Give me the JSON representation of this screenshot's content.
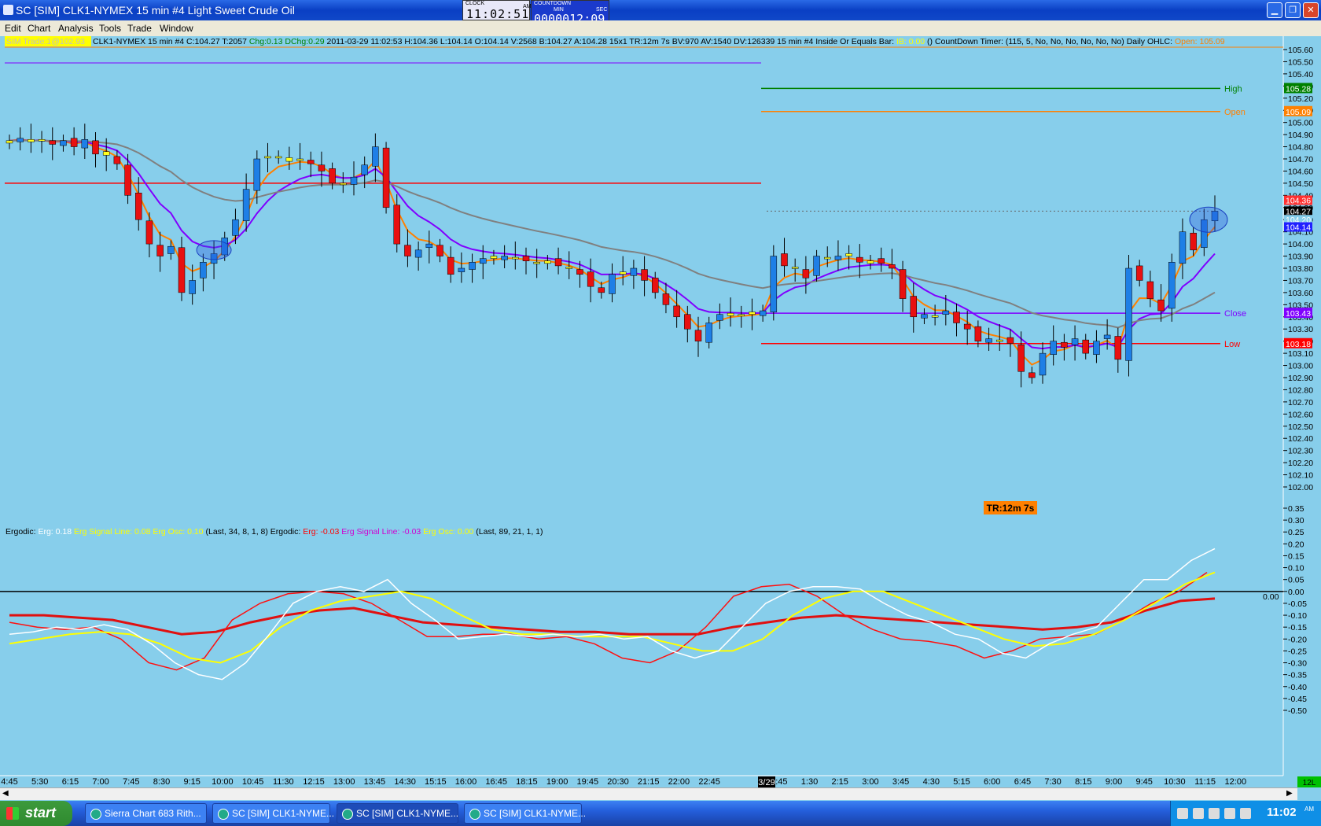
{
  "window": {
    "title": "SC [SIM] CLK1-NYMEX  15 min   #4  Light Sweet Crude Oil"
  },
  "clock": {
    "label": "CLOCK",
    "time": "11:02:51",
    "ampm": "AM"
  },
  "countdown": {
    "label": "COUNTDOWN",
    "min_label": "MIN",
    "sec_label": "SEC",
    "value": "0000012:09"
  },
  "menu": [
    "Edit",
    "Chart",
    "Analysis",
    "Tools",
    "Trade",
    "Window"
  ],
  "info_bar": {
    "sim_trade": "SIM  Trade:1@102.93",
    "segments": [
      {
        "text": "CLK1-NYMEX  15 min   #4 C:104.27 T:2057 ",
        "color": "#000000"
      },
      {
        "text": "Chg:0.13 DChg:0.29 ",
        "color": "#008000"
      },
      {
        "text": "2011-03-29 11:02:53 H:104.36 L:104.14 O:104.14 V:2568 B:104.27 A:104.28 15x1 TR:12m 7s BV:970 AV:1540 DV:126339 15 min  #4  Inside Or Equals Bar: ",
        "color": "#000000"
      },
      {
        "text": "IB: 0.00 ",
        "color": "#ffff00"
      },
      {
        "text": "  ()   CountDown Timer:   (115, 5, No, No, No, No, No, No)   Daily OHLC: ",
        "color": "#000000"
      },
      {
        "text": "Open: 105.09",
        "color": "#ff8000"
      }
    ]
  },
  "ergodic_bar": {
    "segments": [
      {
        "text": "Ergodic:  ",
        "color": "#000000"
      },
      {
        "text": "Erg: 0.18  ",
        "color": "#ffffff"
      },
      {
        "text": "Erg Signal Line: 0.08  ",
        "color": "#ffff00"
      },
      {
        "text": "Erg Osc: 0.10  ",
        "color": "#ffff00"
      },
      {
        "text": "  (Last, 34, 8, 1, 8)   Ergodic:  ",
        "color": "#000000"
      },
      {
        "text": "Erg: -0.03  ",
        "color": "#ff0000"
      },
      {
        "text": "Erg Signal Line: -0.03  ",
        "color": "#d000d0"
      },
      {
        "text": "Erg Osc: 0.00  ",
        "color": "#ffff00"
      },
      {
        "text": "  (Last, 89, 21, 1, 1)",
        "color": "#000000"
      }
    ]
  },
  "levels": [
    {
      "name": "High",
      "value": "105.28",
      "color": "#008000"
    },
    {
      "name": "Open",
      "value": "105.09",
      "color": "#ff8000"
    },
    {
      "name": "Close",
      "value": "103.43",
      "color": "#8000ff"
    },
    {
      "name": "Low",
      "value": "103.18",
      "color": "#ff0000"
    }
  ],
  "price_tags": [
    {
      "value": "104.36",
      "bg": "#ff3030",
      "fg": "#ffffff"
    },
    {
      "value": "104.27",
      "bg": "#000000",
      "fg": "#ffffff"
    },
    {
      "value": "104.20",
      "bg": "#87ceeb",
      "fg": "#ffffff"
    },
    {
      "value": "104.14",
      "bg": "#2020ff",
      "fg": "#ffffff"
    }
  ],
  "tr_label": "TR:12m 7s",
  "zero_label": "0.00",
  "date_marker": "3/29",
  "corner_label": "12L",
  "price_axis": [
    "105.60",
    "105.50",
    "105.40",
    "105.30",
    "105.20",
    "105.10",
    "105.00",
    "104.90",
    "104.80",
    "104.70",
    "104.60",
    "104.50",
    "104.40",
    "104.30",
    "104.20",
    "104.10",
    "104.00",
    "103.90",
    "103.80",
    "103.70",
    "103.60",
    "103.50",
    "103.40",
    "103.30",
    "103.20",
    "103.10",
    "103.00",
    "102.90",
    "102.80",
    "102.70",
    "102.60",
    "102.50",
    "102.40",
    "102.30",
    "102.20",
    "102.10",
    "102.00"
  ],
  "osc_axis": [
    "0.35",
    "0.30",
    "0.25",
    "0.20",
    "0.15",
    "0.10",
    "0.05",
    "0.00",
    "-0.05",
    "-0.10",
    "-0.15",
    "-0.20",
    "-0.25",
    "-0.30",
    "-0.35",
    "-0.40",
    "-0.45",
    "-0.50"
  ],
  "time_axis": [
    "4:45",
    "5:30",
    "6:15",
    "7:00",
    "7:45",
    "8:30",
    "9:15",
    "10:00",
    "10:45",
    "11:30",
    "12:15",
    "13:00",
    "13:45",
    "14:30",
    "15:15",
    "16:00",
    "16:45",
    "18:15",
    "19:00",
    "19:45",
    "20:30",
    "21:15",
    "22:00",
    "22:45",
    "0:45",
    "1:30",
    "2:15",
    "3:00",
    "3:45",
    "4:30",
    "5:15",
    "6:00",
    "6:45",
    "7:30",
    "8:15",
    "9:00",
    "9:45",
    "10:30",
    "11:15",
    "12:00"
  ],
  "candle_closes": [
    104.85,
    104.87,
    104.84,
    104.86,
    104.82,
    104.85,
    104.8,
    104.86,
    104.74,
    104.73,
    104.66,
    104.4,
    104.2,
    104.0,
    103.9,
    103.98,
    103.6,
    103.7,
    103.85,
    103.92,
    104.05,
    104.2,
    104.45,
    104.7,
    104.72,
    104.72,
    104.68,
    104.7,
    104.66,
    104.6,
    104.5,
    104.5,
    104.55,
    104.65,
    104.8,
    104.3,
    104.0,
    103.9,
    103.95,
    104.0,
    103.9,
    103.75,
    103.8,
    103.85,
    103.88,
    103.88,
    103.9,
    103.88,
    103.86,
    103.85,
    103.86,
    103.82,
    103.8,
    103.75,
    103.65,
    103.6,
    103.75,
    103.75,
    103.8,
    103.7,
    103.6,
    103.5,
    103.4,
    103.3,
    103.2,
    103.35,
    103.42,
    103.43,
    103.42,
    103.42,
    103.45,
    103.9,
    103.82,
    103.8,
    103.72,
    103.9,
    103.88,
    103.9,
    103.9,
    103.85,
    103.86,
    103.84,
    103.8,
    103.55,
    103.4,
    103.42,
    103.4,
    103.45,
    103.35,
    103.3,
    103.2,
    103.22,
    103.21,
    103.18,
    102.95,
    102.9,
    103.1,
    103.2,
    103.15,
    103.22,
    103.1,
    103.2,
    103.25,
    103.05,
    103.8,
    103.7,
    103.55,
    103.45,
    103.85,
    104.1,
    103.95,
    104.2,
    104.27
  ],
  "ergodic_white": [
    -0.18,
    -0.17,
    -0.15,
    -0.16,
    -0.14,
    -0.16,
    -0.22,
    -0.3,
    -0.35,
    -0.37,
    -0.3,
    -0.18,
    -0.05,
    0.0,
    0.02,
    0.0,
    0.05,
    -0.05,
    -0.12,
    -0.2,
    -0.19,
    -0.18,
    -0.19,
    -0.18,
    -0.19,
    -0.18,
    -0.2,
    -0.19,
    -0.25,
    -0.28,
    -0.25,
    -0.15,
    -0.05,
    0.0,
    0.02,
    0.02,
    0.01,
    -0.05,
    -0.1,
    -0.13,
    -0.18,
    -0.2,
    -0.26,
    -0.28,
    -0.22,
    -0.18,
    -0.15,
    -0.05,
    0.05,
    0.05,
    0.13,
    0.18
  ],
  "ergodic_red": [
    -0.13,
    -0.15,
    -0.16,
    -0.15,
    -0.2,
    -0.3,
    -0.33,
    -0.28,
    -0.12,
    -0.05,
    -0.01,
    0.0,
    -0.01,
    -0.05,
    -0.12,
    -0.19,
    -0.19,
    -0.18,
    -0.18,
    -0.2,
    -0.19,
    -0.22,
    -0.28,
    -0.3,
    -0.25,
    -0.15,
    -0.02,
    0.02,
    0.03,
    -0.02,
    -0.1,
    -0.16,
    -0.2,
    -0.21,
    -0.23,
    -0.28,
    -0.25,
    -0.2,
    -0.19,
    -0.18,
    -0.12,
    -0.05,
    0.0,
    0.08
  ],
  "ergodic_yellow": [
    -0.22,
    -0.2,
    -0.18,
    -0.17,
    -0.18,
    -0.22,
    -0.28,
    -0.3,
    -0.25,
    -0.15,
    -0.08,
    -0.04,
    -0.02,
    0.0,
    -0.03,
    -0.1,
    -0.16,
    -0.18,
    -0.18,
    -0.19,
    -0.19,
    -0.19,
    -0.22,
    -0.25,
    -0.25,
    -0.2,
    -0.1,
    -0.03,
    0.0,
    0.0,
    -0.05,
    -0.1,
    -0.15,
    -0.2,
    -0.23,
    -0.22,
    -0.18,
    -0.12,
    -0.05,
    0.03,
    0.08
  ],
  "ergodic_thick": [
    -0.1,
    -0.1,
    -0.11,
    -0.12,
    -0.15,
    -0.18,
    -0.17,
    -0.13,
    -0.1,
    -0.08,
    -0.07,
    -0.1,
    -0.13,
    -0.14,
    -0.15,
    -0.16,
    -0.17,
    -0.17,
    -0.18,
    -0.18,
    -0.18,
    -0.15,
    -0.13,
    -0.11,
    -0.1,
    -0.11,
    -0.12,
    -0.13,
    -0.14,
    -0.15,
    -0.16,
    -0.15,
    -0.13,
    -0.08,
    -0.04,
    -0.03
  ],
  "taskbar": {
    "start": "start",
    "tasks": [
      "Sierra Chart 683 Rith...",
      "SC [SIM] CLK1-NYME...",
      "SC [SIM] CLK1-NYME...",
      "SC [SIM] CLK1-NYME..."
    ],
    "time": "11:02",
    "ampm": "AM"
  }
}
